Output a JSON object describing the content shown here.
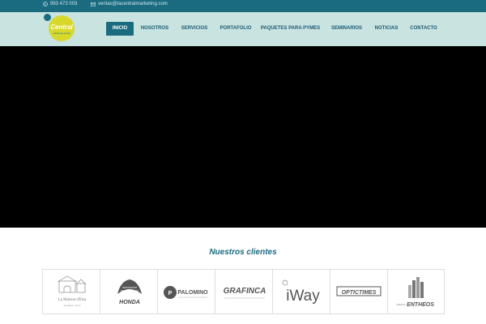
{
  "topbar": {
    "phone": "993 473 003",
    "email": "ventas@lacentralmarketing.com"
  },
  "logo": {
    "text": "Central",
    "tagline": "marketing studio"
  },
  "nav": {
    "items": [
      {
        "label": "INICIO",
        "active": true
      },
      {
        "label": "NOSOTROS",
        "active": false
      },
      {
        "label": "SERVICIOS",
        "active": false
      },
      {
        "label": "PORTAFOLIO",
        "active": false
      },
      {
        "label": "PAQUETES PARA PYMES",
        "active": false
      },
      {
        "label": "SEMINARIOS",
        "active": false
      },
      {
        "label": "NOTICIAS",
        "active": false
      },
      {
        "label": "CONTACTO",
        "active": false
      }
    ]
  },
  "clients": {
    "title": "Nuestros clientes",
    "logos": [
      {
        "name": "La Maison d'Elsa",
        "sub": "Arequipa - Perú"
      },
      {
        "name": "HONDA"
      },
      {
        "name": "PALOMINO"
      },
      {
        "name": "GRAFINCA"
      },
      {
        "name": "iWay"
      },
      {
        "name": "OPTICTIMES"
      },
      {
        "name": "ENTHEOS",
        "sub": "GRUPO"
      }
    ]
  },
  "colors": {
    "brand": "#1b6b80",
    "header_bg": "#c9e3e1",
    "logo_yellow": "#d8d82a"
  }
}
